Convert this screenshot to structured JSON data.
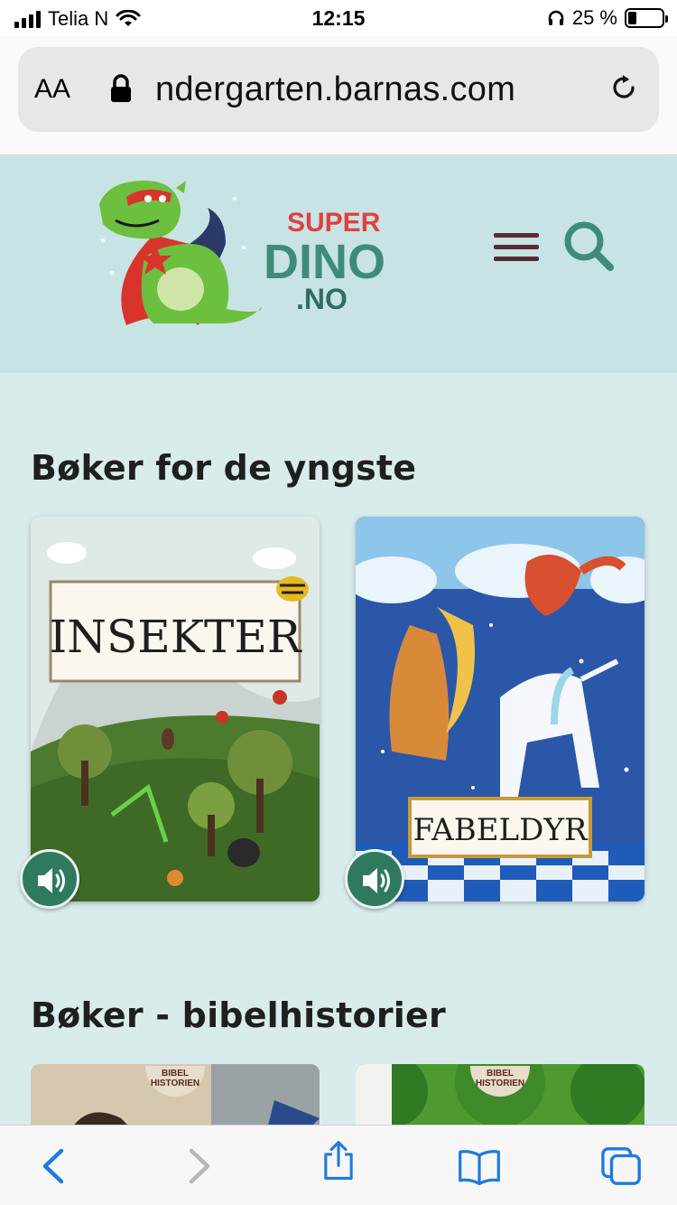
{
  "status": {
    "carrier": "Telia N",
    "time": "12:15",
    "battery_text": "25 %",
    "battery_level": 0.25
  },
  "browser": {
    "text_size_label": "AA",
    "url": "ndergarten.barnas.com"
  },
  "site": {
    "logo_line1": "SUPER",
    "logo_line2": "DINO",
    "logo_line3": ".NO"
  },
  "sections": [
    {
      "title": "Bøker for de yngste",
      "cards": [
        {
          "title": "INSEKTER",
          "audio": true
        },
        {
          "title": "FABELDYR",
          "audio": true
        }
      ]
    },
    {
      "title": "Bøker - bibelhistorier",
      "cards": [
        {
          "badge": "BIBEL HISTORIEN"
        },
        {
          "badge": "BIBEL HISTORIEN"
        }
      ]
    }
  ],
  "colors": {
    "header_bg": "#c8e3e4",
    "page_bg": "#d9ecec",
    "accent_green": "#2f7a5e",
    "menu_color": "#5a2a36",
    "logo_red": "#e0403f",
    "logo_green": "#3e8c78",
    "ios_blue": "#1f7ae0"
  },
  "icons": [
    "signal-icon",
    "wifi-icon",
    "headphones-icon",
    "battery-icon",
    "lock-icon",
    "reload-icon",
    "menu-icon",
    "search-icon",
    "speaker-icon",
    "back-icon",
    "forward-icon",
    "share-icon",
    "bookmarks-icon",
    "tabs-icon"
  ]
}
